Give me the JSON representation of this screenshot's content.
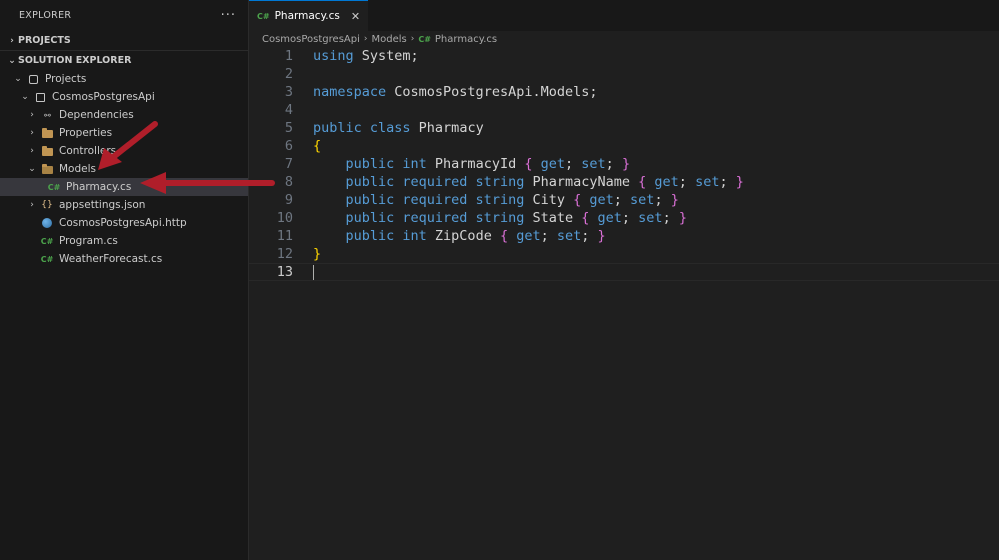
{
  "explorer": {
    "title": "EXPLORER",
    "more": "···",
    "sections": {
      "projects": "PROJECTS",
      "solution_explorer": "SOLUTION EXPLORER"
    }
  },
  "tree": {
    "root": "Projects",
    "project": "CosmosPostgresApi",
    "items": [
      {
        "label": "Dependencies"
      },
      {
        "label": "Properties"
      },
      {
        "label": "Controllers"
      },
      {
        "label": "Models"
      },
      {
        "label": "Pharmacy.cs"
      },
      {
        "label": "appsettings.json"
      },
      {
        "label": "CosmosPostgresApi.http"
      },
      {
        "label": "Program.cs"
      },
      {
        "label": "WeatherForecast.cs"
      }
    ]
  },
  "tab": {
    "label": "Pharmacy.cs",
    "lang_badge": "C#",
    "close": "✕"
  },
  "breadcrumb": {
    "items": [
      "CosmosPostgresApi",
      "Models",
      "Pharmacy.cs"
    ],
    "sep": "›"
  },
  "code": {
    "line_numbers": [
      "1",
      "2",
      "3",
      "4",
      "5",
      "6",
      "7",
      "8",
      "9",
      "10",
      "11",
      "12",
      "13"
    ],
    "line1": {
      "kw": "using",
      "rest": " System;"
    },
    "line3": {
      "kw": "namespace",
      "rest": " CosmosPostgresApi.Models;"
    },
    "line5": {
      "kw": "public class",
      "name": " Pharmacy"
    },
    "line6": "{",
    "props": [
      {
        "mods": "public int",
        "name": " PharmacyId "
      },
      {
        "mods": "public required string",
        "name": " PharmacyName "
      },
      {
        "mods": "public required string",
        "name": " City "
      },
      {
        "mods": "public required string",
        "name": " State "
      },
      {
        "mods": "public int",
        "name": " ZipCode "
      }
    ],
    "accessor_open": "{",
    "accessor_get": "get",
    "accessor_set": "set",
    "accessor_close": "}",
    "line12": "}"
  },
  "colors": {
    "accent": "#0078d4",
    "arrow": "#b01e2a",
    "keyword": "#569cd6",
    "csharp_icon": "#4ca44c"
  },
  "icons": {
    "explorer_more": "ellipsis-icon",
    "folder": "folder-icon",
    "csharp": "csharp-file-icon",
    "json": "json-file-icon",
    "http": "globe-icon"
  }
}
